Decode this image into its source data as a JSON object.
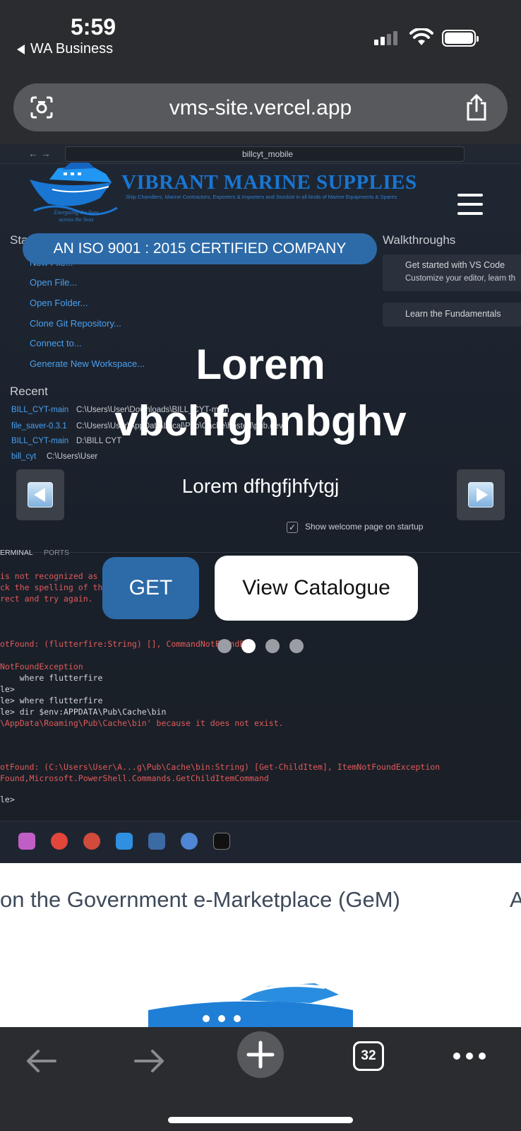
{
  "status_bar": {
    "time": "5:59",
    "back_app": "WA Business"
  },
  "url_bar": {
    "url": "vms-site.vercel.app"
  },
  "background_screenshot": {
    "address": "billcyt_mobile",
    "sidebar_start": "Sta",
    "sidebar_items": [
      "New File...",
      "Open File...",
      "Open Folder...",
      "Clone Git Repository...",
      "Connect to...",
      "Generate New Workspace..."
    ],
    "recent_heading": "Recent",
    "recent_items": [
      {
        "name": "BILL_CYT-main",
        "path": "C:\\Users\\User\\Downloads\\BILL_CYT-main"
      },
      {
        "name": "file_saver-0.3.1",
        "path": "C:\\Users\\User\\AppData\\Local\\Pub\\Cache\\hosted\\pub.dev"
      },
      {
        "name": "BILL_CYT-main",
        "path": "D:\\BILL CYT"
      },
      {
        "name": "bill_cyt",
        "path": "C:\\Users\\User"
      }
    ],
    "walkthroughs_heading": "Walkthroughs",
    "walk_card_title": "Get started with VS Code",
    "walk_card_desc": "Customize your editor, learn th",
    "walk_card2": "Learn the Fundamentals",
    "startup_checkbox": "Show welcome page on startup",
    "panel_tabs": [
      "ERMINAL",
      "PORTS"
    ],
    "terminal_lines": [
      "is not recognized as t",
      "ck the spelling of the",
      "rect and try again.",
      "otFound: (flutterfire:String) [], CommandNotFoundExc",
      "NotFoundException",
      "    where flutterfire",
      "le>",
      "le> where flutterfire",
      "le> dir $env:APPDATA\\Pub\\Cache\\bin",
      "\\AppData\\Roaming\\Pub\\Cache\\bin' because it does not exist.",
      "otFound: (C:\\Users\\User\\A...g\\Pub\\Cache\\bin:String) [Get-ChildItem], ItemNotFoundException",
      "Found,Microsoft.PowerShell.Commands.GetChildItemCommand",
      "le>"
    ]
  },
  "brand": {
    "name": "VIBRANT MARINE SUPPLIES",
    "tagline": "Ship Chandlers, Marine Contractors, Exporters & Importers and Stockist in all kinds of Marine Equipments & Spares",
    "motto": "Energizing the lives across the Seas"
  },
  "hero": {
    "badge": "AN ISO 9001 : 2015 CERTIFIED COMPANY",
    "title_line1": "Lorem",
    "title_line2": "vbchfghnbghv",
    "subtitle": "Lorem dfhgfjhfytgj",
    "btn_get": "GET",
    "btn_catalogue": "View Catalogue",
    "slide_count": 4,
    "active_slide": 2
  },
  "ticker": {
    "text": "on the Government e-Marketplace (GeM)",
    "next_text": "A"
  },
  "toolbar": {
    "tab_count": "32"
  },
  "colors": {
    "brand_blue": "#1976d2",
    "accent": "#2d6aa8"
  }
}
